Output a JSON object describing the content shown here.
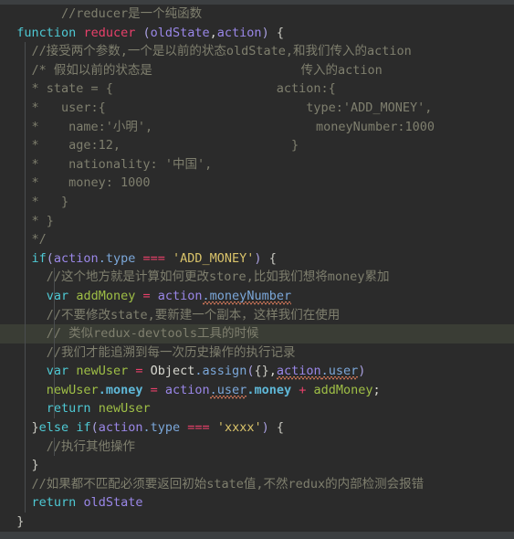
{
  "editor": {
    "language": "javascript",
    "theme": "darcula",
    "background_color": "#2b2b2b",
    "current_line_background": "#3a3d35",
    "chrome_strip_color": "#3c3f41",
    "current_line_index": 17,
    "colors": {
      "comment": "#7f7f6e",
      "keyword": "#4ec9d4",
      "function_name": "#e8406a",
      "parameter": "#9a87e8",
      "property": "#7ba7d9",
      "property_bold": "#5fb8d8",
      "operator": "#e8406a",
      "string": "#d9c36a",
      "variable": "#9fbf46",
      "plain_text": "#d8d8d0",
      "brace": "#c8c8c0",
      "indent_guide": "#4a4d4f",
      "error_squiggle": "#d2785a"
    }
  },
  "code": {
    "lines": [
      {
        "n": 1,
        "guides": [],
        "tokens": [
          {
            "t": "        ",
            "c": "plain"
          },
          {
            "t": "//reducer是一个纯函数",
            "c": "cmt"
          }
        ]
      },
      {
        "n": 2,
        "guides": [],
        "tokens": [
          {
            "t": "  ",
            "c": "plain"
          },
          {
            "t": "function",
            "c": "kw"
          },
          {
            "t": " ",
            "c": "plain"
          },
          {
            "t": "reducer",
            "c": "fn"
          },
          {
            "t": " ",
            "c": "plain"
          },
          {
            "t": "(",
            "c": "punct"
          },
          {
            "t": "oldState",
            "c": "param"
          },
          {
            "t": ",",
            "c": "plain"
          },
          {
            "t": "action",
            "c": "param"
          },
          {
            "t": ")",
            "c": "punct"
          },
          {
            "t": " ",
            "c": "plain"
          },
          {
            "t": "{",
            "c": "brc"
          }
        ]
      },
      {
        "n": 3,
        "guides": [
          "g1"
        ],
        "tokens": [
          {
            "t": "    ",
            "c": "plain"
          },
          {
            "t": "//接受两个参数,一个是以前的状态oldState,和我们传入的action",
            "c": "cmt"
          }
        ]
      },
      {
        "n": 4,
        "guides": [
          "g1"
        ],
        "tokens": [
          {
            "t": "    ",
            "c": "plain"
          },
          {
            "t": "/* 假如以前的状态是                    传入的action",
            "c": "cmt"
          }
        ]
      },
      {
        "n": 5,
        "guides": [
          "g1"
        ],
        "tokens": [
          {
            "t": "    ",
            "c": "plain"
          },
          {
            "t": "* state = {                      action:{",
            "c": "cmt"
          }
        ]
      },
      {
        "n": 6,
        "guides": [
          "g1"
        ],
        "tokens": [
          {
            "t": "    ",
            "c": "plain"
          },
          {
            "t": "*   user:{                           type:'ADD_MONEY',",
            "c": "cmt"
          }
        ]
      },
      {
        "n": 7,
        "guides": [
          "g1"
        ],
        "tokens": [
          {
            "t": "    ",
            "c": "plain"
          },
          {
            "t": "*    name:'小明',                      moneyNumber:1000",
            "c": "cmt"
          }
        ]
      },
      {
        "n": 8,
        "guides": [
          "g1"
        ],
        "tokens": [
          {
            "t": "    ",
            "c": "plain"
          },
          {
            "t": "*    age:12,                       }",
            "c": "cmt"
          }
        ]
      },
      {
        "n": 9,
        "guides": [
          "g1"
        ],
        "tokens": [
          {
            "t": "    ",
            "c": "plain"
          },
          {
            "t": "*    nationality: '中国',",
            "c": "cmt"
          }
        ]
      },
      {
        "n": 10,
        "guides": [
          "g1"
        ],
        "tokens": [
          {
            "t": "    ",
            "c": "plain"
          },
          {
            "t": "*    money: 1000",
            "c": "cmt"
          }
        ]
      },
      {
        "n": 11,
        "guides": [
          "g1"
        ],
        "tokens": [
          {
            "t": "    ",
            "c": "plain"
          },
          {
            "t": "*   }",
            "c": "cmt"
          }
        ]
      },
      {
        "n": 12,
        "guides": [
          "g1"
        ],
        "tokens": [
          {
            "t": "    ",
            "c": "plain"
          },
          {
            "t": "* }",
            "c": "cmt"
          }
        ]
      },
      {
        "n": 13,
        "guides": [
          "g1"
        ],
        "tokens": [
          {
            "t": "    ",
            "c": "plain"
          },
          {
            "t": "*/",
            "c": "cmt"
          }
        ]
      },
      {
        "n": 14,
        "guides": [
          "g1"
        ],
        "tokens": [
          {
            "t": "    ",
            "c": "plain"
          },
          {
            "t": "if",
            "c": "kw"
          },
          {
            "t": "(",
            "c": "punct"
          },
          {
            "t": "action",
            "c": "param"
          },
          {
            "t": ".type",
            "c": "prop"
          },
          {
            "t": " ",
            "c": "plain"
          },
          {
            "t": "===",
            "c": "op"
          },
          {
            "t": " ",
            "c": "plain"
          },
          {
            "t": "'ADD_MONEY'",
            "c": "str"
          },
          {
            "t": ")",
            "c": "punct"
          },
          {
            "t": " ",
            "c": "plain"
          },
          {
            "t": "{",
            "c": "brc"
          }
        ]
      },
      {
        "n": 15,
        "guides": [
          "g1",
          "g2"
        ],
        "tokens": [
          {
            "t": "      ",
            "c": "plain"
          },
          {
            "t": "//这个地方就是计算如何更改store,比如我们想将money累加",
            "c": "cmt"
          }
        ]
      },
      {
        "n": 16,
        "guides": [
          "g1",
          "g2"
        ],
        "tokens": [
          {
            "t": "      ",
            "c": "plain"
          },
          {
            "t": "var",
            "c": "kw"
          },
          {
            "t": " ",
            "c": "plain"
          },
          {
            "t": "addMoney",
            "c": "var"
          },
          {
            "t": " ",
            "c": "plain"
          },
          {
            "t": "=",
            "c": "op"
          },
          {
            "t": " ",
            "c": "plain"
          },
          {
            "t": "action",
            "c": "param"
          },
          {
            "t": ".moneyNumber",
            "c": "prop",
            "squiggle": true
          }
        ]
      },
      {
        "n": 17,
        "guides": [
          "g1",
          "g2"
        ],
        "tokens": [
          {
            "t": "      ",
            "c": "plain"
          },
          {
            "t": "//不要修改state,要新建一个副本，这样我们在使用",
            "c": "cmt"
          }
        ]
      },
      {
        "n": 18,
        "guides": [
          "g1",
          "g2"
        ],
        "current": true,
        "tokens": [
          {
            "t": "      ",
            "c": "plain"
          },
          {
            "t": "// 类似redux-devtools工具的时候",
            "c": "cmt"
          }
        ]
      },
      {
        "n": 19,
        "guides": [
          "g1",
          "g2"
        ],
        "tokens": [
          {
            "t": "      ",
            "c": "plain"
          },
          {
            "t": "//我们才能追溯到每一次历史操作的执行记录",
            "c": "cmt"
          }
        ]
      },
      {
        "n": 20,
        "guides": [
          "g1",
          "g2"
        ],
        "tokens": [
          {
            "t": "      ",
            "c": "plain"
          },
          {
            "t": "var",
            "c": "kw"
          },
          {
            "t": " ",
            "c": "plain"
          },
          {
            "t": "newUser",
            "c": "var"
          },
          {
            "t": " ",
            "c": "plain"
          },
          {
            "t": "=",
            "c": "op"
          },
          {
            "t": " ",
            "c": "plain"
          },
          {
            "t": "Object",
            "c": "plain"
          },
          {
            "t": ".assign",
            "c": "prop"
          },
          {
            "t": "(",
            "c": "punct"
          },
          {
            "t": "{}",
            "c": "brc"
          },
          {
            "t": ",",
            "c": "plain"
          },
          {
            "t": "action",
            "c": "param",
            "squiggle": true
          },
          {
            "t": ".user",
            "c": "prop",
            "squiggle": true
          },
          {
            "t": ")",
            "c": "punct"
          }
        ]
      },
      {
        "n": 21,
        "guides": [
          "g1",
          "g2"
        ],
        "tokens": [
          {
            "t": "      ",
            "c": "plain"
          },
          {
            "t": "newUser",
            "c": "var"
          },
          {
            "t": ".money",
            "c": "propb"
          },
          {
            "t": " ",
            "c": "plain"
          },
          {
            "t": "=",
            "c": "op"
          },
          {
            "t": " ",
            "c": "plain"
          },
          {
            "t": "action",
            "c": "param"
          },
          {
            "t": ".user",
            "c": "prop",
            "squiggle": true
          },
          {
            "t": ".money",
            "c": "propb"
          },
          {
            "t": " ",
            "c": "plain"
          },
          {
            "t": "+",
            "c": "op"
          },
          {
            "t": " ",
            "c": "plain"
          },
          {
            "t": "addMoney",
            "c": "var"
          },
          {
            "t": ";",
            "c": "plain"
          }
        ]
      },
      {
        "n": 22,
        "guides": [
          "g1",
          "g2"
        ],
        "tokens": [
          {
            "t": "      ",
            "c": "plain"
          },
          {
            "t": "return",
            "c": "kw"
          },
          {
            "t": " ",
            "c": "plain"
          },
          {
            "t": "newUser",
            "c": "var"
          }
        ]
      },
      {
        "n": 23,
        "guides": [
          "g1"
        ],
        "tokens": [
          {
            "t": "    ",
            "c": "plain"
          },
          {
            "t": "}",
            "c": "brc"
          },
          {
            "t": "else",
            "c": "kw"
          },
          {
            "t": " ",
            "c": "plain"
          },
          {
            "t": "if",
            "c": "kw"
          },
          {
            "t": "(",
            "c": "punct"
          },
          {
            "t": "action",
            "c": "param"
          },
          {
            "t": ".type",
            "c": "prop"
          },
          {
            "t": " ",
            "c": "plain"
          },
          {
            "t": "===",
            "c": "op"
          },
          {
            "t": " ",
            "c": "plain"
          },
          {
            "t": "'xxxx'",
            "c": "str"
          },
          {
            "t": ")",
            "c": "punct"
          },
          {
            "t": " ",
            "c": "plain"
          },
          {
            "t": "{",
            "c": "brc"
          }
        ]
      },
      {
        "n": 24,
        "guides": [
          "g1",
          "g2"
        ],
        "tokens": [
          {
            "t": "      ",
            "c": "plain"
          },
          {
            "t": "//执行其他操作",
            "c": "cmt"
          }
        ]
      },
      {
        "n": 25,
        "guides": [
          "g1"
        ],
        "tokens": [
          {
            "t": "    ",
            "c": "plain"
          },
          {
            "t": "}",
            "c": "brc"
          }
        ]
      },
      {
        "n": 26,
        "guides": [
          "g1"
        ],
        "tokens": [
          {
            "t": "    ",
            "c": "plain"
          },
          {
            "t": "//如果都不匹配必须要返回初始state值,不然redux的内部检测会报错",
            "c": "cmt"
          }
        ]
      },
      {
        "n": 27,
        "guides": [
          "g1"
        ],
        "tokens": [
          {
            "t": "    ",
            "c": "plain"
          },
          {
            "t": "return",
            "c": "kw"
          },
          {
            "t": " ",
            "c": "plain"
          },
          {
            "t": "oldState",
            "c": "param"
          }
        ]
      },
      {
        "n": 28,
        "guides": [],
        "tokens": [
          {
            "t": "  ",
            "c": "plain"
          },
          {
            "t": "}",
            "c": "brc"
          }
        ]
      }
    ]
  }
}
